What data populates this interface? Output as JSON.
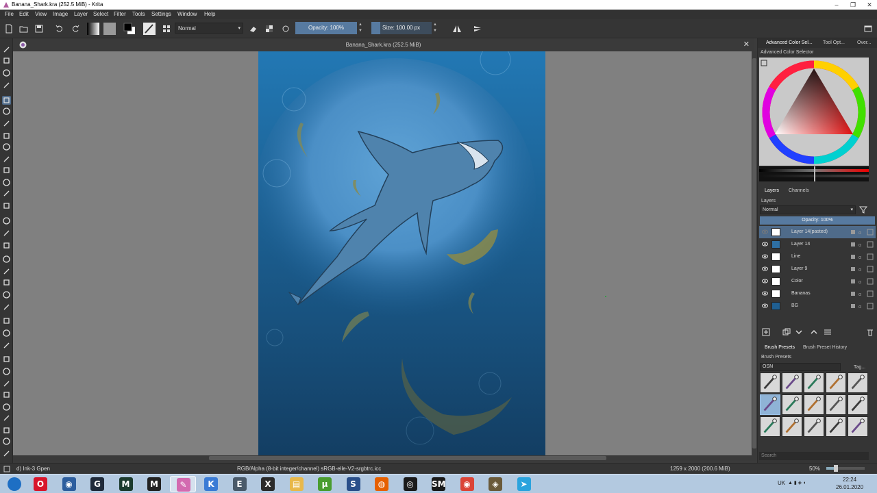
{
  "window": {
    "title": "Banana_Shark.kra (252.5 MiB)  - Krita",
    "minimize_icon": "minimize-icon",
    "maximize_icon": "maximize-icon",
    "close_icon": "close-icon"
  },
  "menu": [
    "File",
    "Edit",
    "View",
    "Image",
    "Layer",
    "Select",
    "Filter",
    "Tools",
    "Settings",
    "Window",
    "Help"
  ],
  "toolbar": {
    "blend_mode": "Normal",
    "opacity_label": "Opacity:  100%",
    "opacity_value": 1.0,
    "size_label": "Size:  100.00 px",
    "size_fill_fraction": 0.15,
    "colors": {
      "accent": "#577aa0",
      "foreground": "#000000",
      "background": "#ffffff"
    }
  },
  "document": {
    "tab_title": "Banana_Shark.kra (252.5 MiB)"
  },
  "docker": {
    "tabs": [
      "Advanced Color Sel...",
      "Tool Opt...",
      "Over..."
    ],
    "color_selector_title": "Advanced Color Selector",
    "layers_tabs": [
      "Layers",
      "Channels"
    ],
    "layers_title": "Layers",
    "layer_blend_mode": "Normal",
    "layer_opacity": "Opacity:  100%",
    "layers": [
      {
        "name": "Layer 14(pasted)",
        "selected": true,
        "visible": false
      },
      {
        "name": "Layer 14",
        "selected": false,
        "visible": true
      },
      {
        "name": "Line",
        "selected": false,
        "visible": true
      },
      {
        "name": "Layer 9",
        "selected": false,
        "visible": true
      },
      {
        "name": "Color",
        "selected": false,
        "visible": true
      },
      {
        "name": "Bananas",
        "selected": false,
        "visible": true
      },
      {
        "name": "BG",
        "selected": false,
        "visible": true
      }
    ],
    "preset_tabs": [
      "Brush Presets",
      "Brush Preset History"
    ],
    "presets_title": "Brush Presets",
    "preset_tag": "OSN",
    "preset_tag_button": "Tag...",
    "preset_search": "Search"
  },
  "status": {
    "brush_name": "d) Ink-3 Gpen",
    "color_profile": "RGB/Alpha (8-bit integer/channel)  sRGB-elle-V2-srgbtrc.icc",
    "image_size": "1259 x 2000 (200.6 MiB)",
    "zoom": "50%",
    "zoom_fraction": 0.2
  },
  "taskbar": {
    "apps": [
      {
        "name": "start-button",
        "glyph": "",
        "color": "#1e6fc4"
      },
      {
        "name": "opera",
        "glyph": "O",
        "color": "#d8152b"
      },
      {
        "name": "firefox-alt",
        "glyph": "◉",
        "color": "#2d5e9e"
      },
      {
        "name": "app-g",
        "glyph": "G",
        "color": "#1f2a3a"
      },
      {
        "name": "app-m-green",
        "glyph": "M",
        "color": "#1c3b2e"
      },
      {
        "name": "app-m",
        "glyph": "M",
        "color": "#222222"
      },
      {
        "name": "krita",
        "glyph": "✎",
        "color": "#d36ab0"
      },
      {
        "name": "krita-alt",
        "glyph": "K",
        "color": "#3a7bd5"
      },
      {
        "name": "app-e",
        "glyph": "E",
        "color": "#4a5a6a"
      },
      {
        "name": "app-x",
        "glyph": "X",
        "color": "#2b2b2b"
      },
      {
        "name": "explorer",
        "glyph": "▤",
        "color": "#e8b84a"
      },
      {
        "name": "utorrent",
        "glyph": "µ",
        "color": "#4a9d2f"
      },
      {
        "name": "app-s",
        "glyph": "S",
        "color": "#2a4f8a"
      },
      {
        "name": "firefox",
        "glyph": "◍",
        "color": "#e66000"
      },
      {
        "name": "obs",
        "glyph": "◎",
        "color": "#1a1a1a"
      },
      {
        "name": "app-sm",
        "glyph": "SM",
        "color": "#1a1a1a"
      },
      {
        "name": "chrome",
        "glyph": "◉",
        "color": "#db4437"
      },
      {
        "name": "app-w",
        "glyph": "◈",
        "color": "#6a5a3a"
      },
      {
        "name": "telegram",
        "glyph": "➤",
        "color": "#2aa3dd"
      }
    ],
    "language": "UK",
    "time": "22:24",
    "date": "26.01.2020"
  }
}
